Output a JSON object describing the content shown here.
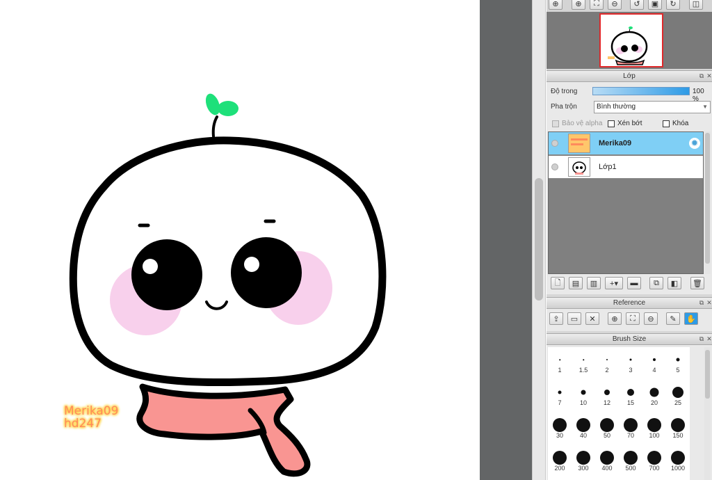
{
  "canvas": {
    "watermark_line1": "Merika09",
    "watermark_line2": "hd247"
  },
  "navigator": {
    "buttons": [
      "zoom-fit-icon",
      "zoom-in-icon",
      "fit-window-icon",
      "zoom-out-icon",
      "rotate-left-icon",
      "flip-icon",
      "rotate-right-icon",
      "split-icon"
    ]
  },
  "layer_panel": {
    "title": "Lớp",
    "opacity_label": "Độ trong",
    "opacity_value": "100 %",
    "opacity": 1.0,
    "blend_label": "Pha trộn",
    "blend_value": "Bình thường",
    "protect_alpha_label": "Bảo vệ alpha",
    "clipping_label": "Xén bớt",
    "lock_label": "Khóa",
    "layers": [
      {
        "name": "Merika09",
        "selected": true
      },
      {
        "name": "Lớp1",
        "selected": false
      }
    ]
  },
  "reference_panel": {
    "title": "Reference"
  },
  "brush_panel": {
    "title": "Brush Size",
    "sizes": [
      "1",
      "1.5",
      "2",
      "3",
      "4",
      "5",
      "7",
      "10",
      "12",
      "15",
      "20",
      "25",
      "30",
      "40",
      "50",
      "70",
      "100",
      "150",
      "200",
      "300",
      "400",
      "500",
      "700",
      "1000"
    ]
  },
  "colors": {
    "selection_blue": "#7fcff5",
    "accent_red": "#e0282a",
    "opacity_blue": "#2e9be6",
    "scarf": "#f99592",
    "blush": "#f8d0ec",
    "leaf": "#1ee07a"
  }
}
